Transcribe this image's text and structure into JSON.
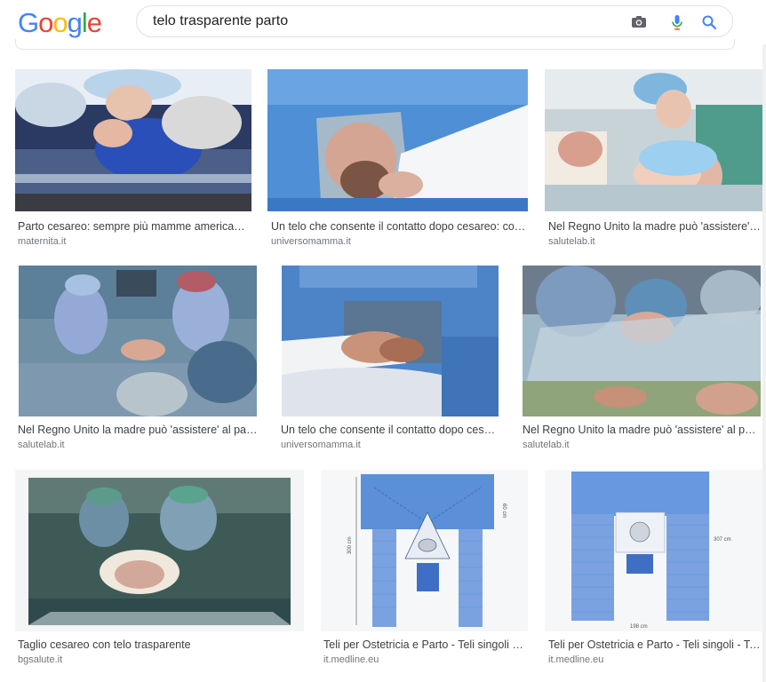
{
  "logo": [
    "G",
    "o",
    "o",
    "g",
    "l",
    "e"
  ],
  "logo_colors": [
    "#4285F4",
    "#EA4335",
    "#FBBC05",
    "#4285F4",
    "#34A853",
    "#EA4335"
  ],
  "search": {
    "query": "telo trasparente parto"
  },
  "icons": {
    "camera": "camera-icon",
    "mic": "microphone-icon",
    "search": "search-icon"
  },
  "results": [
    {
      "caption": "Parto cesareo: sempre più mamme americane...",
      "source": "maternita.it"
    },
    {
      "caption": "Un telo che consente il contatto dopo cesareo: cos'...",
      "source": "universomamma.it"
    },
    {
      "caption": "Nel Regno Unito la madre può 'assistere' al ...",
      "source": "salutelab.it"
    },
    {
      "caption": "Nel Regno Unito la madre può 'assistere' al parto...",
      "source": "salutelab.it"
    },
    {
      "caption": "Un telo che consente il contatto dopo cesar...",
      "source": "universomamma.it"
    },
    {
      "caption": "Nel Regno Unito la madre può 'assistere' al parto...",
      "source": "salutelab.it"
    },
    {
      "caption": "Taglio cesareo con telo trasparente",
      "source": "bgsalute.it"
    },
    {
      "caption": "Teli per Ostetricia e Parto - Teli singoli - ...",
      "source": "it.medline.eu"
    },
    {
      "caption": "Teli per Ostetricia e Parto - Teli singoli - Teli...",
      "source": "it.medline.eu"
    }
  ],
  "diagram_labels": {
    "d1_height": "300 cm",
    "d1_side": "60 cm",
    "d2_height": "307 cm",
    "d2_width": "198 cm"
  }
}
